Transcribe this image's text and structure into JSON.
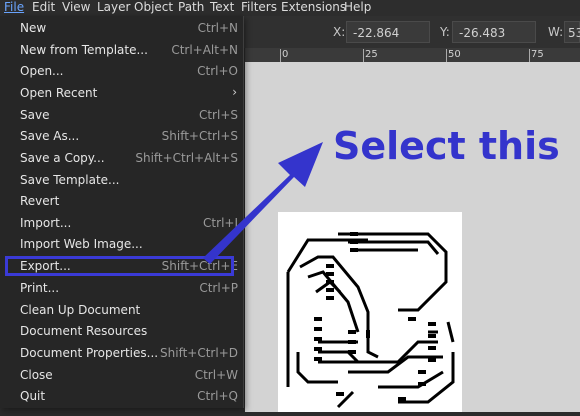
{
  "menubar": {
    "items": [
      "File",
      "Edit",
      "View",
      "Layer",
      "Object",
      "Path",
      "Text",
      "Filters",
      "Extensions",
      "Help"
    ]
  },
  "toolbar": {
    "x_label": "X:",
    "x_value": "-22.864",
    "y_label": "Y:",
    "y_value": "-26.483",
    "w_label": "W:",
    "w_value": "53"
  },
  "ruler": {
    "labels": [
      "0",
      "25",
      "50",
      "75"
    ]
  },
  "file_menu": {
    "items": [
      {
        "label": "New",
        "shortcut": "Ctrl+N"
      },
      {
        "label": "New from Template...",
        "shortcut": "Ctrl+Alt+N"
      },
      {
        "label": "Open...",
        "shortcut": "Ctrl+O"
      },
      {
        "label": "Open Recent",
        "shortcut": "",
        "submenu": true
      },
      {
        "label": "Save",
        "shortcut": "Ctrl+S"
      },
      {
        "label": "Save As...",
        "shortcut": "Shift+Ctrl+S"
      },
      {
        "label": "Save a Copy...",
        "shortcut": "Shift+Ctrl+Alt+S"
      },
      {
        "label": "Save Template...",
        "shortcut": ""
      },
      {
        "label": "Revert",
        "shortcut": ""
      },
      {
        "label": "Import...",
        "shortcut": "Ctrl+I"
      },
      {
        "label": "Import Web Image...",
        "shortcut": ""
      },
      {
        "label": "Export...",
        "shortcut": "Shift+Ctrl+E"
      },
      {
        "label": "Print...",
        "shortcut": "Ctrl+P"
      },
      {
        "label": "Clean Up Document",
        "shortcut": ""
      },
      {
        "label": "Document Resources",
        "shortcut": ""
      },
      {
        "label": "Document Properties...",
        "shortcut": "Shift+Ctrl+D"
      },
      {
        "label": "Close",
        "shortcut": "Ctrl+W"
      },
      {
        "label": "Quit",
        "shortcut": "Ctrl+Q"
      }
    ]
  },
  "annotation": {
    "text": "Select this",
    "color": "#3434cc"
  },
  "colors": {
    "accent": "#3a3ad6",
    "menu_bg": "#262626",
    "canvas_bg": "#d3d3d3"
  }
}
